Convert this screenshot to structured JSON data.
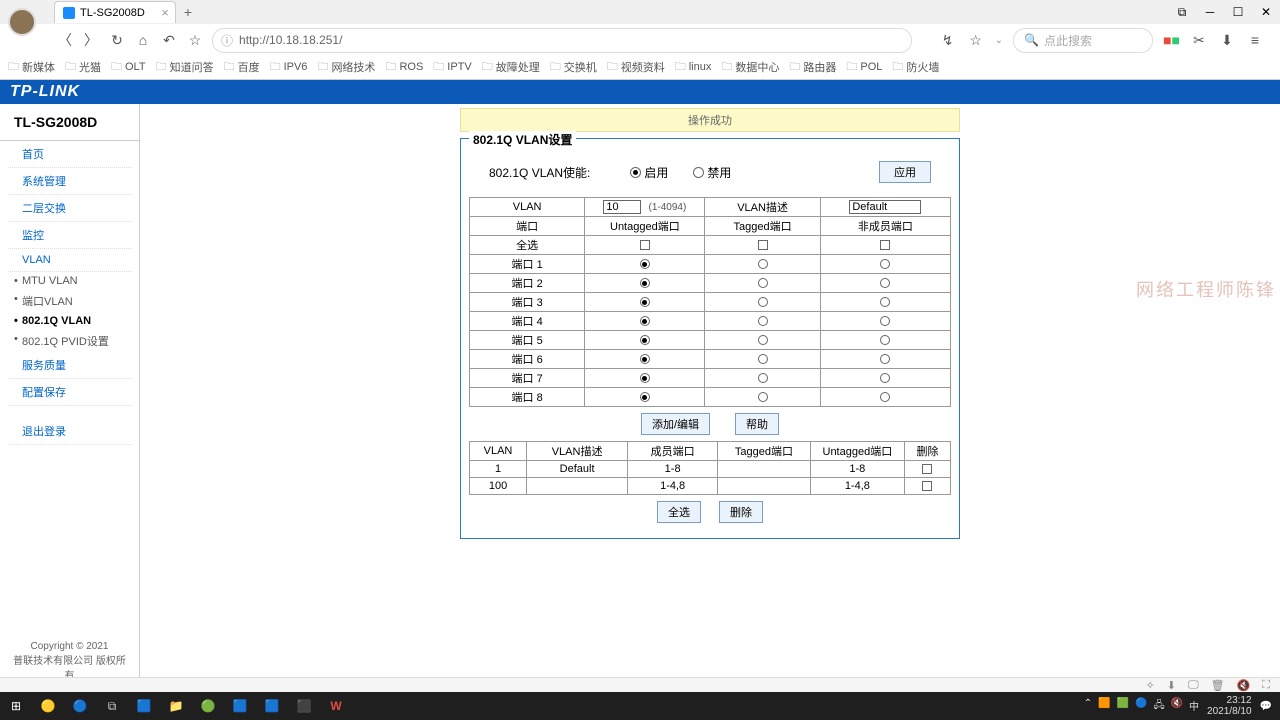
{
  "browser": {
    "tab_title": "TL-SG2008D",
    "url": "http://10.18.18.251/",
    "search_placeholder": "点此搜索"
  },
  "bookmarks": [
    "新媒体",
    "光猫",
    "OLT",
    "知道问答",
    "百度",
    "IPV6",
    "网络技术",
    "ROS",
    "IPTV",
    "故障处理",
    "交换机",
    "视频资料",
    "linux",
    "数据中心",
    "路由器",
    "POL",
    "防火墙"
  ],
  "header": {
    "logo": "TP-LINK",
    "model": "TL-SG2008D"
  },
  "sidebar": {
    "items": [
      "首页",
      "系统管理",
      "二层交换",
      "监控",
      "VLAN"
    ],
    "subitems": [
      "MTU VLAN",
      "端口VLAN",
      "802.1Q VLAN",
      "802.1Q PVID设置"
    ],
    "active_sub": 2,
    "bottom": [
      "服务质量",
      "配置保存"
    ],
    "logout": "退出登录",
    "copyright1": "Copyright © 2021",
    "copyright2": "普联技术有限公司 版权所有"
  },
  "success_msg": "操作成功",
  "panel": {
    "title": "802.1Q VLAN设置",
    "enable_label": "802.1Q VLAN使能:",
    "enable_on": "启用",
    "enable_off": "禁用",
    "apply": "应用",
    "top_table": {
      "vlan_hdr": "VLAN",
      "vlan_value": "10",
      "vlan_range": "(1-4094)",
      "desc_hdr": "VLAN描述",
      "desc_value": "Default",
      "port_hdr": "端口",
      "untag_hdr": "Untagged端口",
      "tag_hdr": "Tagged端口",
      "non_hdr": "非成员端口",
      "allsel": "全选",
      "ports": [
        "端口 1",
        "端口 2",
        "端口 3",
        "端口 4",
        "端口 5",
        "端口 6",
        "端口 7",
        "端口 8"
      ],
      "untagged": [
        true,
        true,
        true,
        true,
        true,
        true,
        true,
        true
      ],
      "tagged": [
        false,
        false,
        false,
        false,
        false,
        false,
        false,
        false
      ],
      "nonmember": [
        false,
        false,
        false,
        false,
        false,
        false,
        false,
        false
      ]
    },
    "mid_buttons": {
      "add_edit": "添加/编辑",
      "help": "帮助"
    },
    "bottom_table": {
      "headers": [
        "VLAN",
        "VLAN描述",
        "成员端口",
        "Tagged端口",
        "Untagged端口",
        "删除"
      ],
      "rows": [
        {
          "vlan": "1",
          "desc": "Default",
          "members": "1-8",
          "tagged": "",
          "untagged": "1-8",
          "del": false
        },
        {
          "vlan": "100",
          "desc": "",
          "members": "1-4,8",
          "tagged": "",
          "untagged": "1-4,8",
          "del": false
        }
      ]
    },
    "bot_buttons": {
      "selall": "全选",
      "delete": "删除"
    }
  },
  "watermark": "网络工程师陈锋",
  "tray": {
    "time": "23:12",
    "date": "2021/8/10"
  }
}
